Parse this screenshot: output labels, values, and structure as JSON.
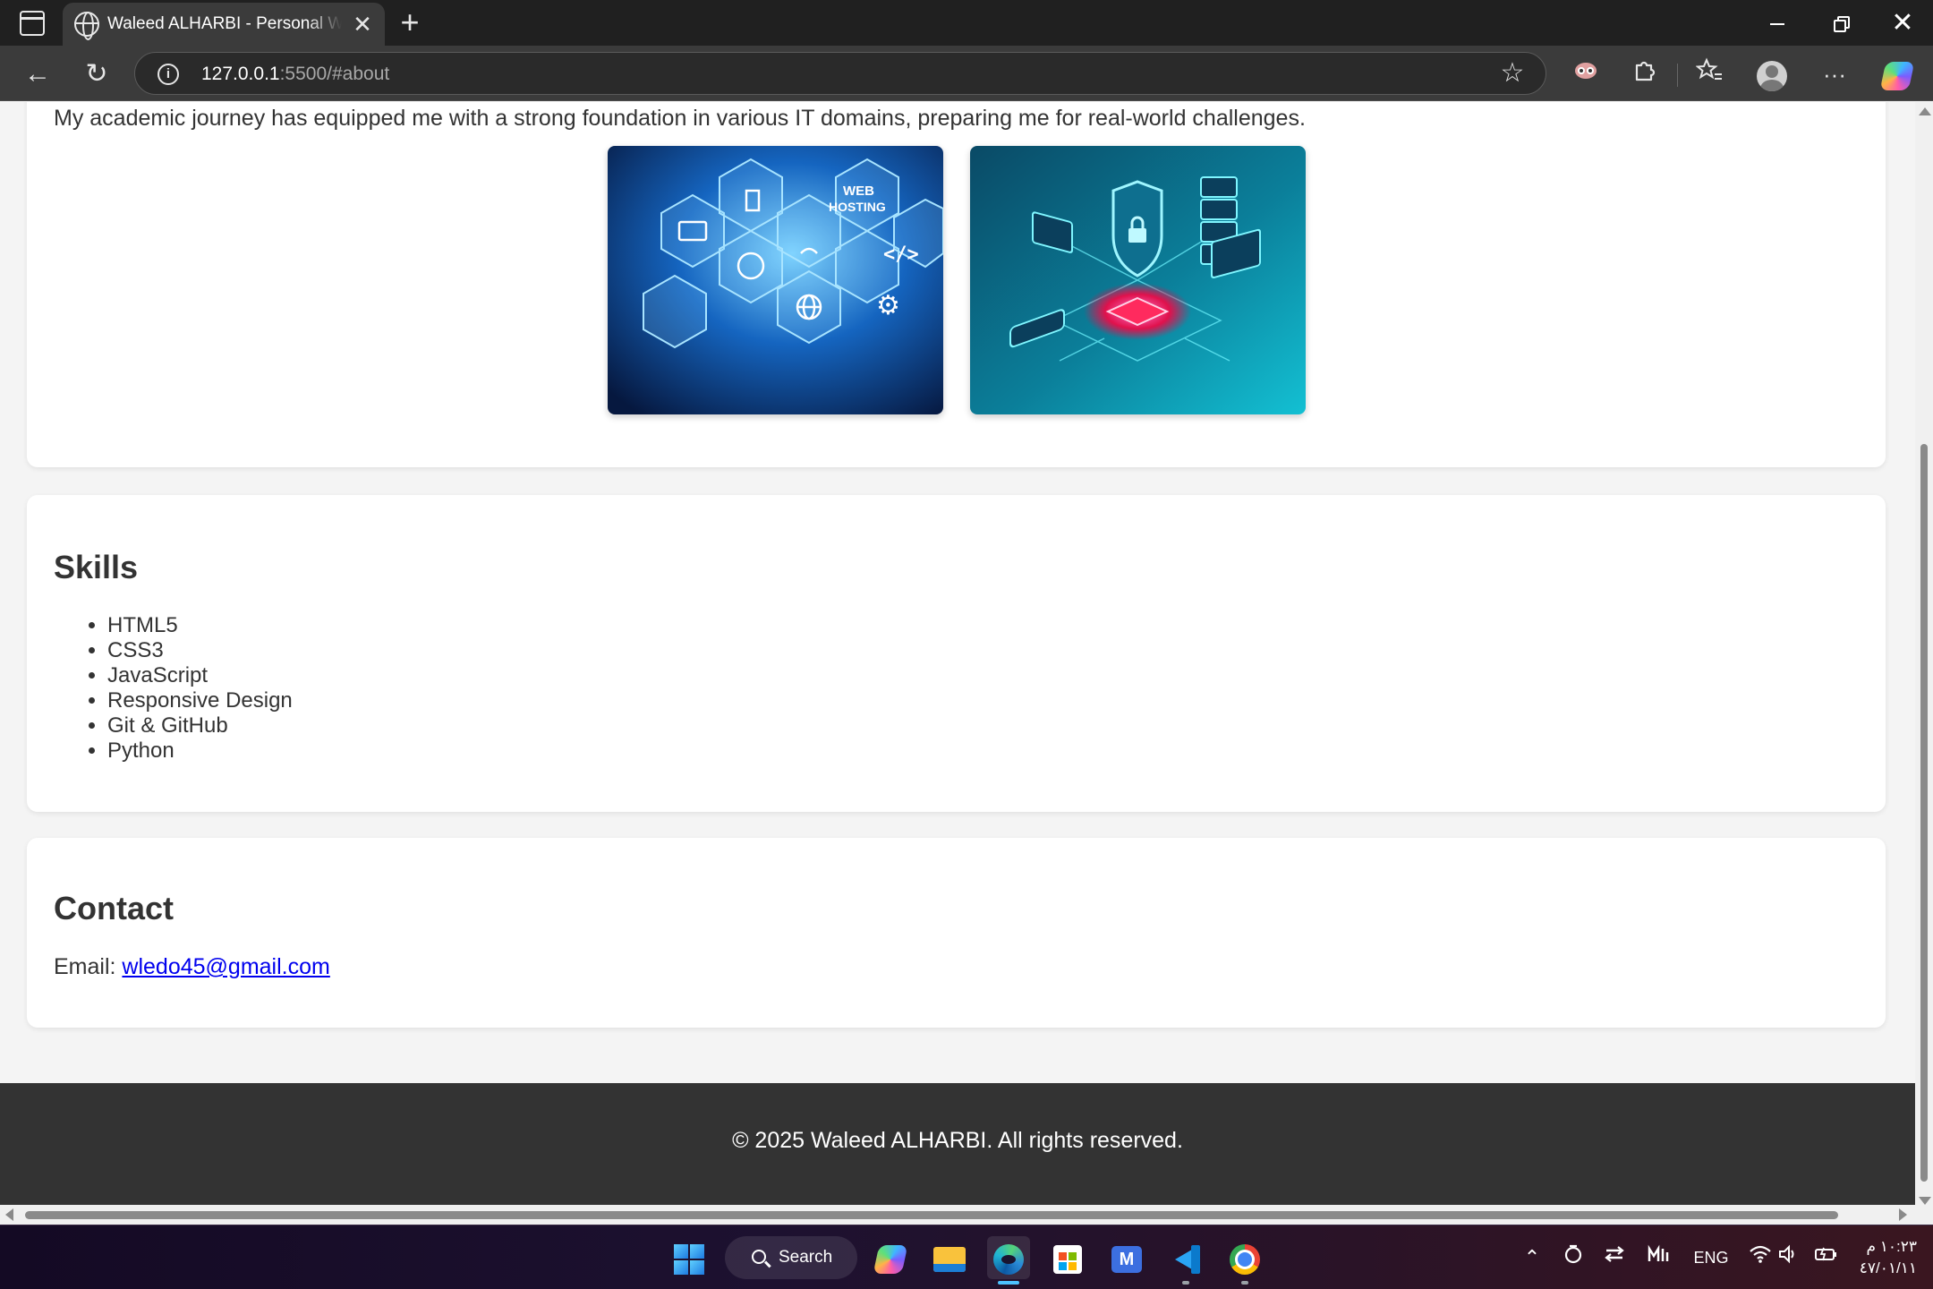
{
  "browser": {
    "tab_title": "Waleed ALHARBI - Personal Website",
    "url_host": "127.0.0.1",
    "url_rest": ":5500/#about"
  },
  "about": {
    "text": "My academic journey has equipped me with a strong foundation in various IT domains, preparing me for real-world challenges.",
    "image1_text_line1": "WEB",
    "image1_text_line2": "HOSTING"
  },
  "skills": {
    "title": "Skills",
    "items": [
      "HTML5",
      "CSS3",
      "JavaScript",
      "Responsive Design",
      "Git & GitHub",
      "Python"
    ]
  },
  "contact": {
    "title": "Contact",
    "email_label": "Email:",
    "email": "wledo45@gmail.com"
  },
  "footer": {
    "text": "© 2025 Waleed ALHARBI. All rights reserved."
  },
  "taskbar": {
    "search_label": "Search",
    "language": "ENG",
    "time": "١٠:٢٣ م",
    "date": "٤٧/٠١/١١"
  },
  "colors": {
    "link": "#0000ee",
    "footer_bg": "#333333",
    "card_bg": "#ffffff",
    "page_bg": "#f4f4f4"
  }
}
